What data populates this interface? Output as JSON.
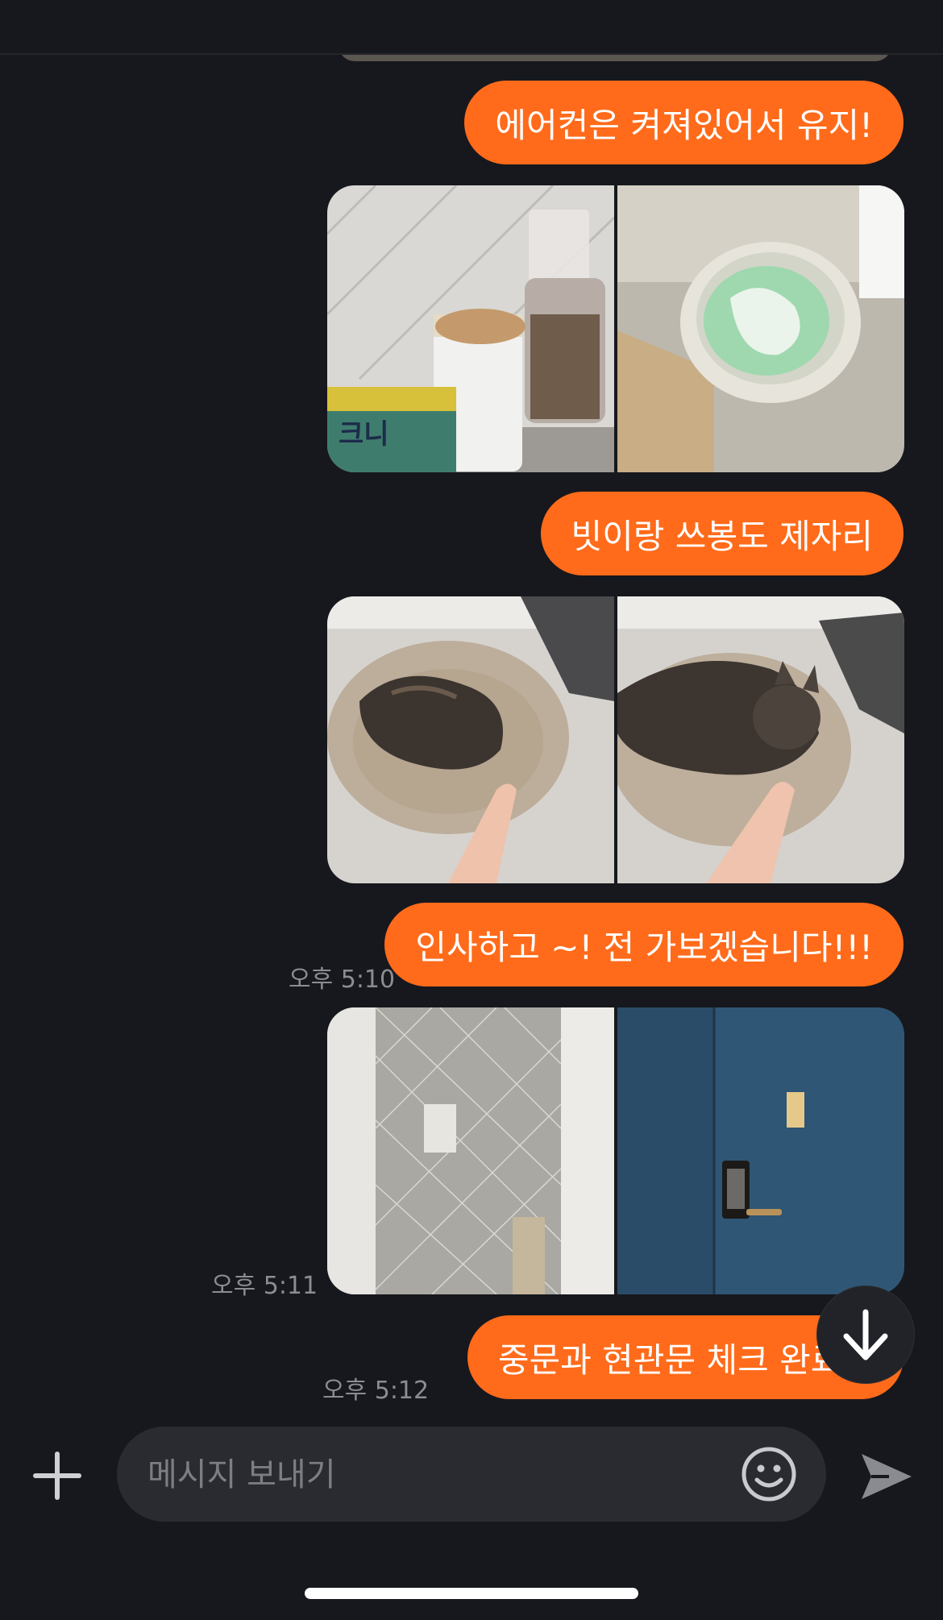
{
  "messages": [
    {
      "kind": "text",
      "text": "에어컨은 켜져있어서 유지!"
    },
    {
      "kind": "photos",
      "photos": [
        "food-shelf-photo",
        "litter-box-photo"
      ]
    },
    {
      "kind": "text",
      "text": "빗이랑 쓰봉도 제자리"
    },
    {
      "kind": "photos",
      "photos": [
        "cat-in-bed-photo",
        "cat-petted-photo"
      ]
    },
    {
      "kind": "text",
      "text": "인사하고 ~! 전 가보겠습니다!!!",
      "time": "오후 5:10"
    },
    {
      "kind": "photos",
      "photos": [
        "inner-door-photo",
        "front-door-photo"
      ],
      "time": "오후 5:11"
    },
    {
      "kind": "text",
      "text": "중문과 현관문 체크 완료요",
      "time": "오후 5:12"
    }
  ],
  "composer": {
    "placeholder": "메시지 보내기",
    "add_icon": "plus-icon",
    "emoji_icon": "smiley-icon",
    "send_icon": "send-icon"
  },
  "scroll_button_icon": "arrow-down-icon",
  "colors": {
    "background": "#17181d",
    "bubble": "#ff6b1a",
    "input": "#2a2b31",
    "timestamp": "#8c8d93"
  }
}
